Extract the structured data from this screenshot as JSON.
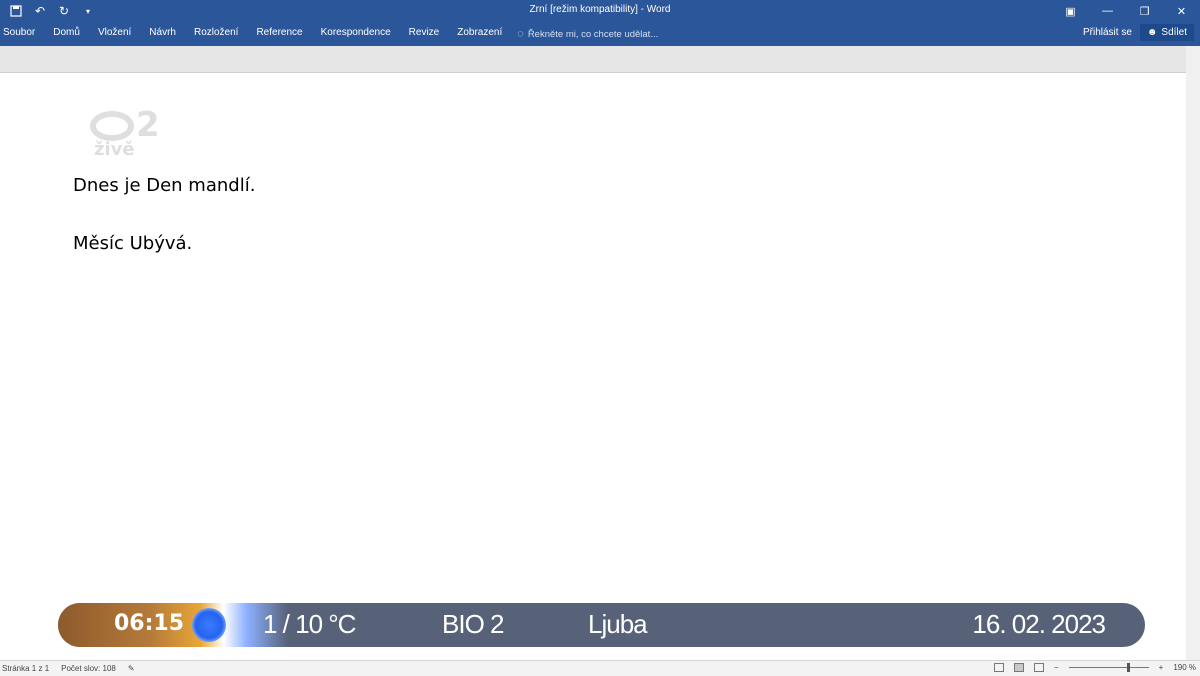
{
  "window": {
    "title": "Zrní [režim kompatibility] - Word"
  },
  "ribbon": {
    "tabs": [
      "Soubor",
      "Domů",
      "Vložení",
      "Návrh",
      "Rozložení",
      "Reference",
      "Korespondence",
      "Revize",
      "Zobrazení"
    ],
    "tell_me_placeholder": "Řekněte mi, co chcete udělat...",
    "sign_in": "Přihlásit se",
    "share": "Sdílet"
  },
  "document": {
    "paragraphs": [
      "Dnes je Den mandlí.",
      "Měsíc Ubývá."
    ]
  },
  "watermark": {
    "number": "2",
    "text": "živě"
  },
  "statusbar": {
    "page": "Stránka 1 z 1",
    "words": "Počet slov: 108",
    "zoom": "190 %"
  },
  "tv_overlay": {
    "time": "06:15",
    "temperature": "1 / 10 °C",
    "channel": "BIO 2",
    "nameday": "Ljuba",
    "date": "16. 02. 2023"
  },
  "colors": {
    "ribbon": "#2b579a",
    "tv_band": "#576278"
  }
}
